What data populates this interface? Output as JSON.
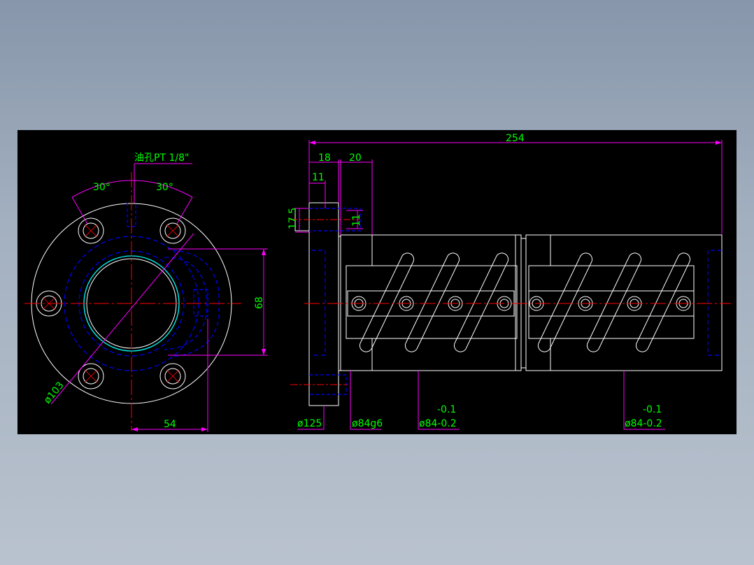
{
  "colors": {
    "background": "#000000",
    "outline": "#ffffff",
    "centerline": "#ff0000",
    "hidden": "#0000ff",
    "dimension": "#ff00ff",
    "text": "#00ff00",
    "bore": "#00ffff"
  },
  "front_view": {
    "oil_hole_note": "油孔PT 1/8\"",
    "angle_left": "30°",
    "angle_right": "30°",
    "dim_68": "68",
    "dim_103": "ø103",
    "dim_54": "54"
  },
  "side_view": {
    "dim_254": "254",
    "dim_18": "18",
    "dim_20": "20",
    "dim_11_top": "11",
    "dim_17_5": "17.5",
    "dim_11_side": "11",
    "dim_125": "ø125",
    "dim_84g6": "ø84g6",
    "tol_a_upper": "-0.1",
    "tol_a_main": "ø84-0.2",
    "tol_b_upper": "-0.1",
    "tol_b_main": "ø84-0.2"
  }
}
